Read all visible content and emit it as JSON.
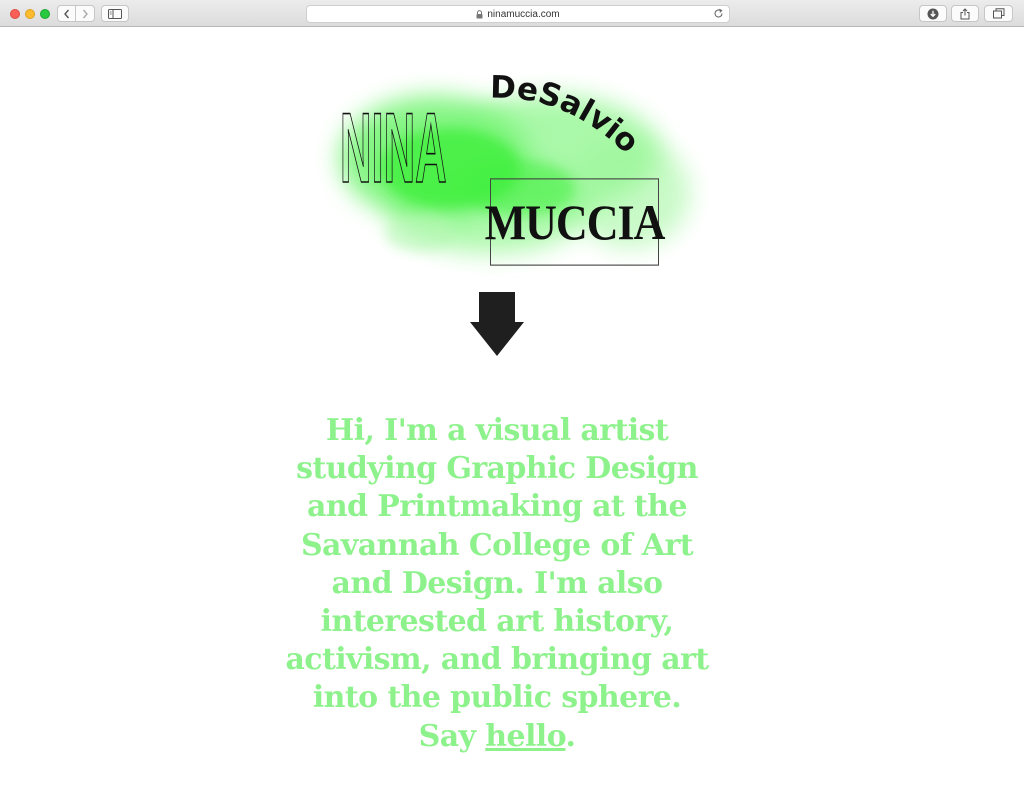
{
  "browser": {
    "url": "ninamuccia.com"
  },
  "logo": {
    "first_name": "NINA",
    "middle_name": "DeSalvio",
    "last_name": "MUCCIA",
    "blob_color": "#3cf03a"
  },
  "bio": {
    "lines": [
      "Hi, I'm a visual artist",
      "studying Graphic Design",
      "and Printmaking at the",
      "Savannah College of Art",
      "and Design. I'm also",
      "interested art history,",
      "activism, and bringing art",
      "into the public sphere."
    ],
    "say_prefix": "Say",
    "link_text": "hello",
    "say_suffix": ".",
    "text_color": "#8ef28c"
  },
  "icons": {
    "back": "chevron-left-icon",
    "forward": "chevron-right-icon",
    "sidebar": "sidebar-icon",
    "lock": "lock-icon",
    "reload": "reload-icon",
    "download": "download-icon",
    "share": "share-icon",
    "tabs": "tabs-icon",
    "arrow": "down-arrow-icon"
  }
}
